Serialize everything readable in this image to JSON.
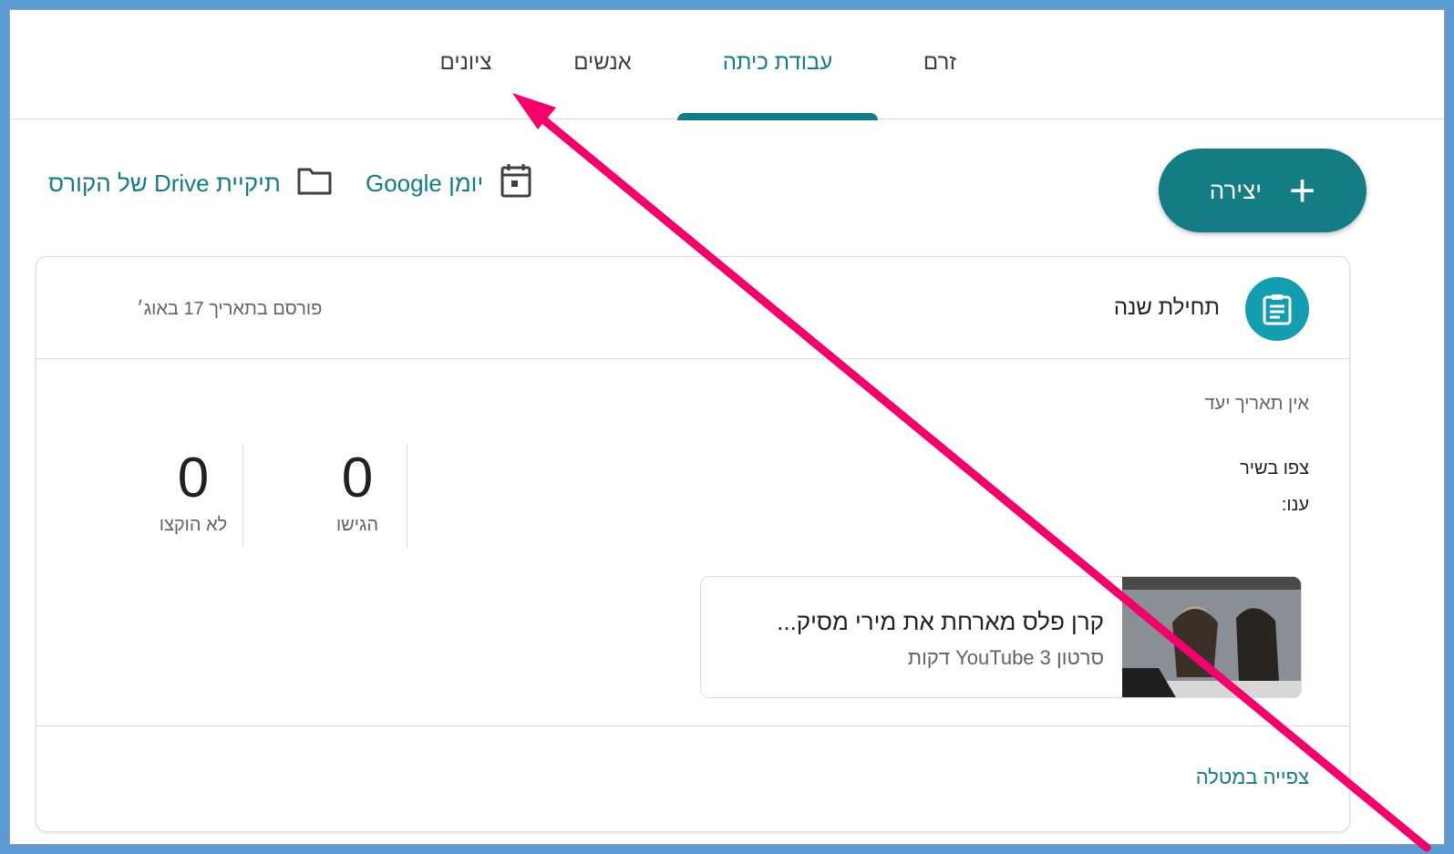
{
  "tabs": [
    {
      "label": "זרם",
      "active": false
    },
    {
      "label": "עבודת כיתה",
      "active": true
    },
    {
      "label": "אנשים",
      "active": false
    },
    {
      "label": "ציונים",
      "active": false
    }
  ],
  "toolbar": {
    "create_label": "יצירה",
    "calendar_label": "יומן Google",
    "drive_label": "תיקיית Drive של הקורס"
  },
  "assignment": {
    "title": "תחילת שנה",
    "posted": "פורסם בתאריך 17 באוג׳",
    "due": "אין תאריך יעד",
    "instructions_line1": "צפו בשיר",
    "instructions_line2": "ענו:",
    "stats": [
      {
        "value": "0",
        "caption": "הגישו"
      },
      {
        "value": "0",
        "caption": "לא הוקצו"
      }
    ],
    "attachment": {
      "title": "קרן פלס מארחת את מירי מסיק...",
      "subtitle": "סרטון YouTube   3 דקות"
    },
    "view_link": "צפייה במטלה"
  },
  "colors": {
    "accent": "#137c84",
    "icon_bg": "#129eaf",
    "annotation_arrow": "#f5006a",
    "frame_border": "#5b9bd5"
  },
  "icons": [
    "plus-icon",
    "calendar-icon",
    "folder-icon",
    "assignment-icon",
    "video-thumbnail"
  ]
}
